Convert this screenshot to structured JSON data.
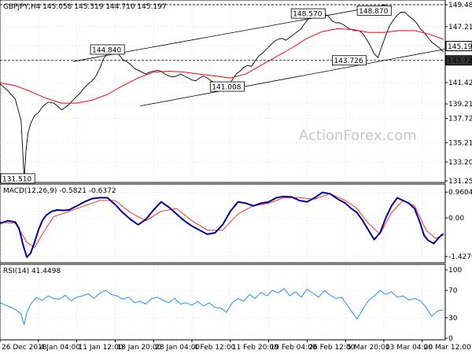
{
  "chart_data": {
    "type": "line",
    "title": "GBPJPY,H4  145.058 145.319 144.710 145.197",
    "watermark": "ActionForex.com",
    "colors": {
      "price": "#000000",
      "moving_average": "#ff0000",
      "channel": "#000000",
      "macd": "#00008b",
      "signal": "#ff0000",
      "rsi": "#1e90ff",
      "grid": "#c0c0c0",
      "level_tag_dark": "#333333",
      "label_box": "#ffffff"
    },
    "x_axis": {
      "labels": [
        "26 Dec 2018",
        "4 Jan 04:00",
        "11 Jan 12:00",
        "18 Jan 20:00",
        "28 Jan 04:00",
        "4 Feb 12:00",
        "11 Feb 20:00",
        "19 Feb 04:00",
        "26 Feb 12:00",
        "5 Mar 20:00",
        "13 Mar 04:00",
        "20 Mar 12:00"
      ],
      "range": [
        0,
        11.6
      ]
    },
    "price_pane": {
      "ylim": [
        131.25,
        149.8
      ],
      "y_ticks": [
        "149.480",
        "147.210",
        "145.197",
        "143.720",
        "141.425",
        "139.215",
        "137.725",
        "135.215",
        "133.205",
        "131.250"
      ],
      "y_tick_values": [
        149.48,
        147.21,
        145.197,
        143.72,
        141.425,
        139.215,
        137.725,
        135.215,
        133.205,
        131.25
      ],
      "highlight_tags": [
        "145.197",
        "143.720"
      ],
      "guide_levels": [
        149.48,
        143.72
      ],
      "annotations": [
        {
          "label": "131.510",
          "x": 0.17,
          "y": 131.51
        },
        {
          "label": "144.840",
          "x": 2.8,
          "y": 144.84
        },
        {
          "label": "141.008",
          "x": 5.92,
          "y": 141.01
        },
        {
          "label": "148.570",
          "x": 8.03,
          "y": 148.57
        },
        {
          "label": "143.726",
          "x": 9.1,
          "y": 143.72
        },
        {
          "label": "148.870",
          "x": 9.75,
          "y": 148.87
        }
      ],
      "channel": [
        {
          "name": "upper",
          "x": [
            1.9,
            10.1
          ],
          "y": [
            143.6,
            149.5
          ]
        },
        {
          "name": "lower",
          "x": [
            3.65,
            11.75
          ],
          "y": [
            139.0,
            145.0
          ]
        }
      ],
      "price_points": {
        "x": [
          0.0,
          0.2,
          0.4,
          0.55,
          0.63,
          0.68,
          0.73,
          0.8,
          0.9,
          1.0,
          1.1,
          1.25,
          1.4,
          1.5,
          1.6,
          1.75,
          1.9,
          2.0,
          2.1,
          2.2,
          2.3,
          2.4,
          2.5,
          2.6,
          2.7,
          2.8,
          2.9,
          3.0,
          3.1,
          3.2,
          3.3,
          3.4,
          3.5,
          3.6,
          3.7,
          3.8,
          3.9,
          4.0,
          4.1,
          4.2,
          4.3,
          4.4,
          4.5,
          4.6,
          4.7,
          4.8,
          4.9,
          5.0,
          5.1,
          5.2,
          5.3,
          5.4,
          5.5,
          5.6,
          5.7,
          5.8,
          5.9,
          5.95,
          6.05,
          6.15,
          6.25,
          6.35,
          6.45,
          6.55,
          6.65,
          6.75,
          6.85,
          6.95,
          7.05,
          7.15,
          7.25,
          7.35,
          7.45,
          7.55,
          7.65,
          7.75,
          7.85,
          7.95,
          8.05,
          8.15,
          8.25,
          8.35,
          8.45,
          8.55,
          8.65,
          8.75,
          8.85,
          8.95,
          9.05,
          9.15,
          9.25,
          9.35,
          9.45,
          9.55,
          9.65,
          9.75,
          9.85,
          9.95,
          10.05,
          10.15,
          10.25,
          10.35,
          10.45,
          10.55,
          10.6,
          10.65,
          10.75,
          10.85,
          10.95,
          11.05,
          11.15,
          11.25,
          11.35,
          11.45,
          11.55
        ],
        "y": [
          141.3,
          140.6,
          139.7,
          137.5,
          131.5,
          134.5,
          136.2,
          137.2,
          138.0,
          138.3,
          138.9,
          139.4,
          139.3,
          139.0,
          138.6,
          139.0,
          139.6,
          140.0,
          140.4,
          140.9,
          141.3,
          141.6,
          142.1,
          142.9,
          143.9,
          144.4,
          144.5,
          144.6,
          144.3,
          143.8,
          143.6,
          143.3,
          142.9,
          142.7,
          142.5,
          142.3,
          142.5,
          142.6,
          142.7,
          142.6,
          142.3,
          142.1,
          142.0,
          142.1,
          142.3,
          142.1,
          141.9,
          141.7,
          141.6,
          141.9,
          142.1,
          141.9,
          141.6,
          141.4,
          141.2,
          141.4,
          141.1,
          141.0,
          141.7,
          142.3,
          142.6,
          143.0,
          143.2,
          143.1,
          143.7,
          144.2,
          144.5,
          144.9,
          145.3,
          145.7,
          145.9,
          146.0,
          145.8,
          146.1,
          146.4,
          146.7,
          147.0,
          147.6,
          148.1,
          148.5,
          148.4,
          148.3,
          148.5,
          148.3,
          147.8,
          147.6,
          147.6,
          147.4,
          147.1,
          146.9,
          146.8,
          146.8,
          146.5,
          145.9,
          145.2,
          144.4,
          144.0,
          145.2,
          146.3,
          147.3,
          147.9,
          148.4,
          148.7,
          148.7,
          148.5,
          148.3,
          148.0,
          147.6,
          147.0,
          146.6,
          146.1,
          145.6,
          145.3,
          145.0,
          144.6
        ]
      },
      "moving_average": {
        "x": [
          0.0,
          0.4,
          0.8,
          1.2,
          1.6,
          2.0,
          2.4,
          2.8,
          3.2,
          3.6,
          4.0,
          4.4,
          4.8,
          5.2,
          5.6,
          6.0,
          6.4,
          6.8,
          7.2,
          7.6,
          8.0,
          8.4,
          8.8,
          9.2,
          9.6,
          10.0,
          10.4,
          10.8,
          11.2,
          11.55
        ],
        "y": [
          141.4,
          141.1,
          140.5,
          139.8,
          139.3,
          139.3,
          139.6,
          140.2,
          141.1,
          141.9,
          142.5,
          142.6,
          142.5,
          142.3,
          142.1,
          141.9,
          142.3,
          143.2,
          144.1,
          145.0,
          146.0,
          146.7,
          147.0,
          146.9,
          146.6,
          146.6,
          146.8,
          146.8,
          146.4,
          145.9
        ]
      }
    },
    "macd_pane": {
      "label": "MACD(12,26,9) -0.5821 -0.6372",
      "ylim": [
        -1.6,
        1.2
      ],
      "y_ticks": [
        "0.9604",
        "0.00",
        "-1.4279"
      ],
      "y_tick_values": [
        0.9604,
        0.0,
        -1.4279
      ],
      "macd": {
        "x": [
          0.0,
          0.2,
          0.4,
          0.5,
          0.6,
          0.7,
          0.8,
          0.9,
          1.0,
          1.1,
          1.2,
          1.35,
          1.5,
          1.65,
          1.8,
          2.0,
          2.2,
          2.4,
          2.6,
          2.8,
          3.0,
          3.2,
          3.4,
          3.6,
          3.8,
          4.0,
          4.2,
          4.4,
          4.6,
          4.8,
          5.0,
          5.2,
          5.4,
          5.6,
          5.8,
          6.0,
          6.2,
          6.4,
          6.6,
          6.8,
          7.0,
          7.2,
          7.4,
          7.6,
          7.8,
          8.0,
          8.2,
          8.4,
          8.6,
          8.8,
          9.0,
          9.15,
          9.3,
          9.45,
          9.6,
          9.75,
          9.9,
          10.05,
          10.2,
          10.35,
          10.5,
          10.65,
          10.8,
          10.95,
          11.05,
          11.15,
          11.3,
          11.45,
          11.55
        ],
        "y": [
          -0.2,
          -0.1,
          -0.15,
          -0.4,
          -1.0,
          -1.45,
          -1.3,
          -0.9,
          -0.45,
          -0.1,
          0.1,
          0.25,
          0.3,
          0.28,
          0.3,
          0.45,
          0.6,
          0.72,
          0.75,
          0.75,
          0.5,
          0.2,
          -0.05,
          -0.25,
          -0.05,
          0.3,
          0.6,
          0.4,
          0.15,
          -0.1,
          -0.3,
          -0.45,
          -0.6,
          -0.55,
          -0.25,
          0.25,
          0.6,
          0.55,
          0.45,
          0.55,
          0.6,
          0.75,
          0.8,
          0.78,
          0.65,
          0.6,
          0.75,
          0.95,
          0.9,
          0.7,
          0.55,
          0.35,
          0.2,
          -0.1,
          -0.45,
          -0.8,
          -0.55,
          0.0,
          0.45,
          0.75,
          0.65,
          0.55,
          0.35,
          -0.2,
          -0.65,
          -0.82,
          -0.95,
          -0.7,
          -0.58
        ]
      },
      "signal": {
        "x": [
          0.0,
          0.4,
          0.7,
          0.9,
          1.1,
          1.4,
          1.8,
          2.2,
          2.6,
          3.0,
          3.4,
          3.8,
          4.2,
          4.6,
          5.0,
          5.4,
          5.8,
          6.2,
          6.6,
          7.0,
          7.4,
          7.8,
          8.2,
          8.6,
          9.0,
          9.3,
          9.6,
          9.9,
          10.2,
          10.5,
          10.8,
          11.1,
          11.35,
          11.55
        ],
        "y": [
          -0.15,
          -0.2,
          -0.9,
          -1.1,
          -0.6,
          0.05,
          0.25,
          0.45,
          0.65,
          0.65,
          0.2,
          -0.1,
          0.25,
          0.35,
          -0.1,
          -0.45,
          -0.45,
          0.15,
          0.45,
          0.55,
          0.75,
          0.75,
          0.7,
          0.9,
          0.65,
          0.35,
          -0.2,
          -0.6,
          0.2,
          0.65,
          0.45,
          -0.45,
          -0.75,
          -0.64
        ]
      }
    },
    "rsi_pane": {
      "label": "RSI(14) 41.4498",
      "ylim": [
        0,
        100
      ],
      "y_ticks": [
        "100",
        "70",
        "30",
        "0"
      ],
      "y_tick_values": [
        100,
        70,
        30,
        0
      ],
      "rsi": {
        "x": [
          0.0,
          0.15,
          0.3,
          0.45,
          0.55,
          0.63,
          0.7,
          0.8,
          0.95,
          1.1,
          1.25,
          1.4,
          1.55,
          1.7,
          1.85,
          2.0,
          2.15,
          2.3,
          2.45,
          2.6,
          2.75,
          2.9,
          3.05,
          3.2,
          3.35,
          3.5,
          3.65,
          3.8,
          3.95,
          4.1,
          4.25,
          4.4,
          4.55,
          4.7,
          4.85,
          5.0,
          5.15,
          5.3,
          5.45,
          5.6,
          5.75,
          5.9,
          6.05,
          6.2,
          6.35,
          6.5,
          6.65,
          6.8,
          6.95,
          7.1,
          7.25,
          7.4,
          7.55,
          7.7,
          7.85,
          8.0,
          8.15,
          8.3,
          8.45,
          8.6,
          8.75,
          8.9,
          9.05,
          9.15,
          9.3,
          9.45,
          9.6,
          9.75,
          9.9,
          10.05,
          10.2,
          10.35,
          10.5,
          10.65,
          10.8,
          10.95,
          11.1,
          11.25,
          11.4,
          11.55
        ],
        "y": [
          52,
          48,
          45,
          40,
          35,
          20,
          38,
          50,
          60,
          55,
          62,
          58,
          57,
          63,
          55,
          60,
          62,
          65,
          58,
          66,
          70,
          64,
          62,
          57,
          60,
          52,
          54,
          50,
          58,
          60,
          55,
          52,
          58,
          50,
          52,
          48,
          54,
          47,
          52,
          45,
          44,
          38,
          52,
          58,
          54,
          64,
          58,
          67,
          62,
          70,
          66,
          73,
          62,
          68,
          60,
          72,
          66,
          60,
          70,
          63,
          58,
          60,
          48,
          40,
          28,
          42,
          55,
          62,
          70,
          64,
          68,
          60,
          62,
          56,
          58,
          55,
          45,
          32,
          40,
          41.45
        ]
      }
    }
  }
}
